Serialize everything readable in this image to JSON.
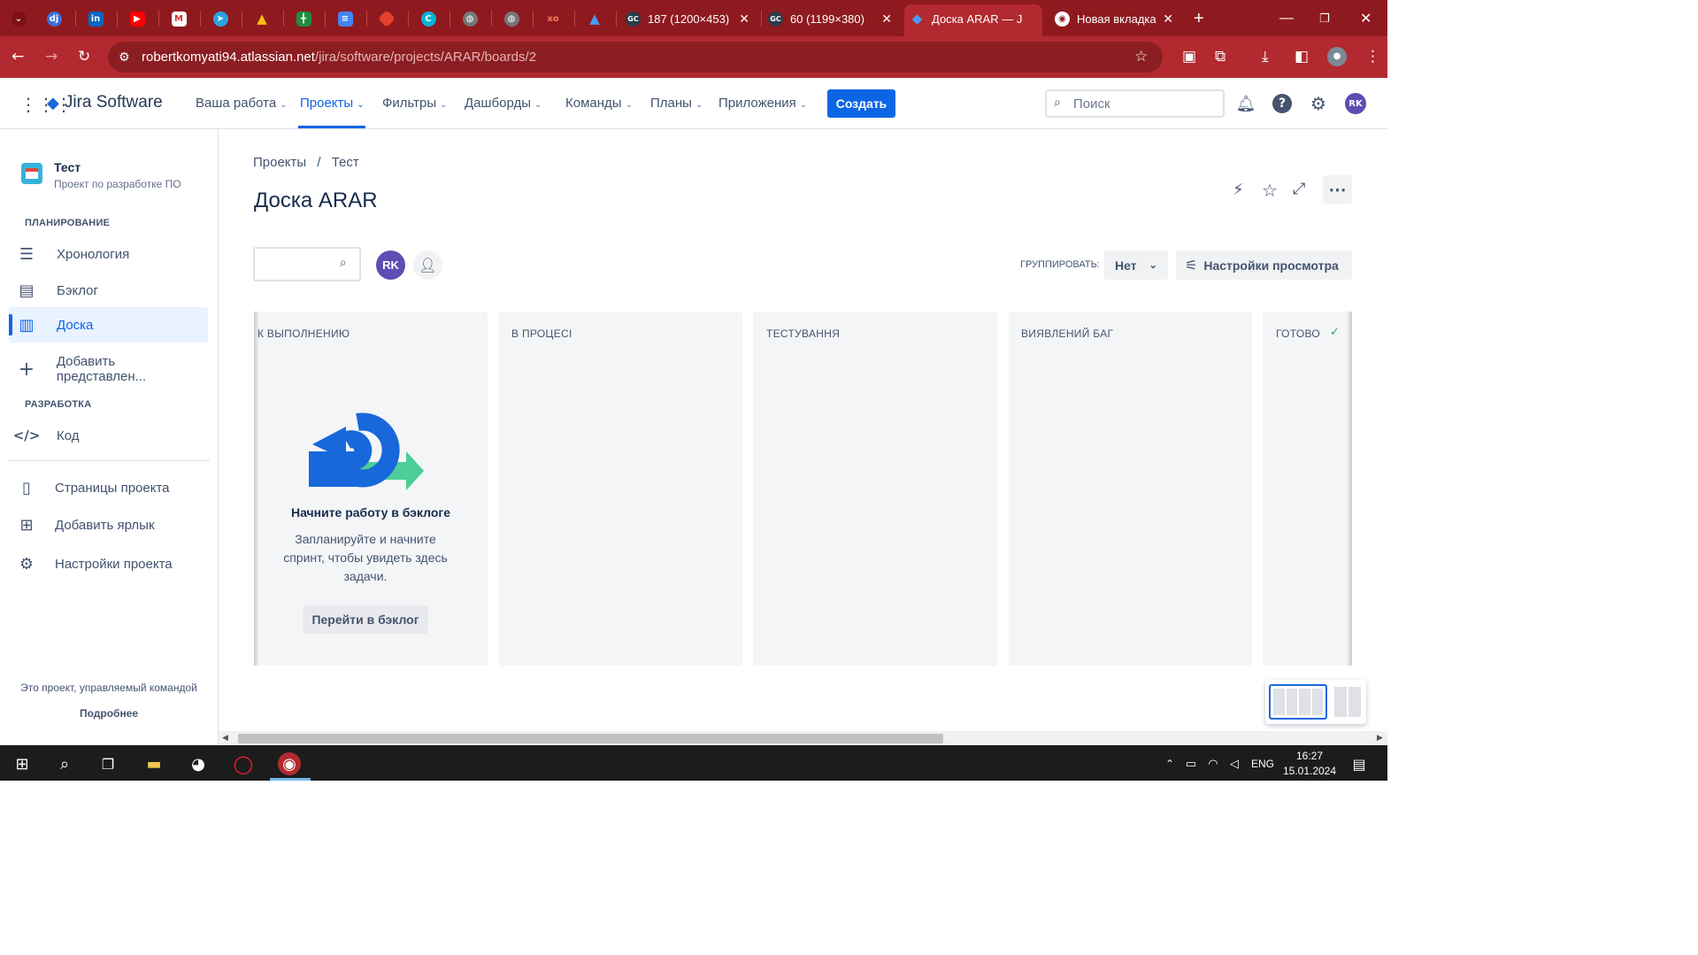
{
  "browser": {
    "tabs": [
      {
        "title": "187 (1200×453)"
      },
      {
        "title": "60 (1199×380)"
      },
      {
        "title": "Доска ARAR — J"
      },
      {
        "title": "Новая вкладка"
      }
    ],
    "new_tab_symbol": "+",
    "url_host": "robertkomyati94.atlassian.net",
    "url_path": "/jira/software/projects/ARAR/boards/2",
    "colors": {
      "frame": "#8e1a1f",
      "toolbar": "#b22a2f"
    }
  },
  "jira": {
    "app_name": "Jira Software",
    "nav": [
      "Ваша работа",
      "Проекты",
      "Фильтры",
      "Дашборды",
      "Команды",
      "Планы",
      "Приложения"
    ],
    "create_label": "Создать",
    "search_placeholder": "Поиск",
    "user_initials": "RK",
    "accent": "#0c66e4"
  },
  "sidebar": {
    "project_name": "Тест",
    "project_type": "Проект по разработке ПО",
    "planning_heading": "ПЛАНИРОВАНИЕ",
    "planning_items": [
      "Хронология",
      "Бэклог",
      "Доска",
      "Добавить представлен..."
    ],
    "dev_heading": "РАЗРАБОТКА",
    "dev_items": [
      "Код"
    ],
    "other_items": [
      "Страницы проекта",
      "Добавить ярлык",
      "Настройки проекта"
    ],
    "footer_text": "Это проект, управляемый командой",
    "footer_link": "Подробнее"
  },
  "board": {
    "breadcrumb": [
      "Проекты",
      "Тест"
    ],
    "title": "Доска ARAR",
    "group_label": "ГРУППИРОВАТЬ:",
    "group_value": "Нет",
    "view_settings": "Настройки просмотра",
    "columns": [
      "К ВЫПОЛНЕНИЮ",
      "В ПРОЦЕСІ",
      "ТЕСТУВАННЯ",
      "ВИЯВЛЕНИЙ БАГ",
      "ГОТОВО"
    ],
    "empty_title": "Начните работу в бэклоге",
    "empty_text": "Запланируйте и начните спринт, чтобы увидеть здесь задачи.",
    "empty_button": "Перейти в бэклог"
  },
  "taskbar": {
    "lang": "ENG",
    "time": "16:27",
    "date": "15.01.2024"
  }
}
